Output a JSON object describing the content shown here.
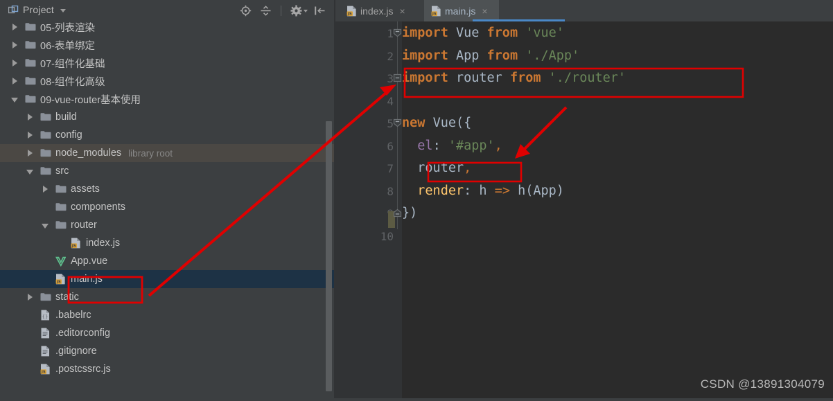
{
  "window": {
    "theme_bg": "#3c3f41",
    "editor_bg": "#2b2b2b",
    "accent": "#4a88c7",
    "annotation_color": "#e00000",
    "selection_bg": "#1d3245"
  },
  "sidebar": {
    "title": "Project",
    "title_caret": "▾",
    "toolbar": [
      {
        "name": "locate-icon",
        "tooltip": "Select Opened File"
      },
      {
        "name": "collapse-all-icon",
        "tooltip": "Collapse All"
      },
      {
        "name": "separator",
        "tooltip": ""
      },
      {
        "name": "gear-icon",
        "tooltip": "Settings"
      },
      {
        "name": "hide-panel-icon",
        "tooltip": "Hide"
      }
    ],
    "tree": [
      {
        "label": "05-列表渲染",
        "indent": 0,
        "kind": "folder",
        "state": "closed",
        "clipped": true
      },
      {
        "label": "06-表单绑定",
        "indent": 0,
        "kind": "folder",
        "state": "closed"
      },
      {
        "label": "07-组件化基础",
        "indent": 0,
        "kind": "folder",
        "state": "closed"
      },
      {
        "label": "08-组件化高级",
        "indent": 0,
        "kind": "folder",
        "state": "closed"
      },
      {
        "label": "09-vue-router基本使用",
        "indent": 0,
        "kind": "folder",
        "state": "open"
      },
      {
        "label": "build",
        "indent": 1,
        "kind": "folder",
        "state": "closed"
      },
      {
        "label": "config",
        "indent": 1,
        "kind": "folder",
        "state": "closed"
      },
      {
        "label": "node_modules",
        "sub": "library root",
        "indent": 1,
        "kind": "folder",
        "state": "closed",
        "hover": true
      },
      {
        "label": "src",
        "indent": 1,
        "kind": "folder",
        "state": "open"
      },
      {
        "label": "assets",
        "indent": 2,
        "kind": "folder",
        "state": "closed"
      },
      {
        "label": "components",
        "indent": 2,
        "kind": "folder",
        "state": "leaf"
      },
      {
        "label": "router",
        "indent": 2,
        "kind": "folder",
        "state": "open"
      },
      {
        "label": "index.js",
        "indent": 3,
        "kind": "js"
      },
      {
        "label": "App.vue",
        "indent": 2,
        "kind": "vue"
      },
      {
        "label": "main.js",
        "indent": 2,
        "kind": "js",
        "selected": true
      },
      {
        "label": "static",
        "indent": 1,
        "kind": "folder",
        "state": "closed"
      },
      {
        "label": ".babelrc",
        "indent": 1,
        "kind": "babel"
      },
      {
        "label": ".editorconfig",
        "indent": 1,
        "kind": "file"
      },
      {
        "label": ".gitignore",
        "indent": 1,
        "kind": "file"
      },
      {
        "label": ".postcssrc.js",
        "indent": 1,
        "kind": "js"
      }
    ]
  },
  "editor": {
    "tabs": [
      {
        "label": "index.js",
        "icon": "js-file-icon",
        "active": false,
        "close": "×"
      },
      {
        "label": "main.js",
        "icon": "js-file-icon",
        "active": true,
        "close": "×"
      }
    ],
    "line_numbers": [
      "1",
      "2",
      "3",
      "4",
      "5",
      "6",
      "7",
      "8",
      "9",
      "10"
    ],
    "lines": [
      {
        "n": 1,
        "text": "import Vue from 'vue'"
      },
      {
        "n": 2,
        "text": "import App from './App'"
      },
      {
        "n": 3,
        "text": "import router from './router'"
      },
      {
        "n": 4,
        "text": ""
      },
      {
        "n": 5,
        "text": "new Vue({"
      },
      {
        "n": 6,
        "text": "  el: '#app',"
      },
      {
        "n": 7,
        "text": "  router,"
      },
      {
        "n": 8,
        "text": "  render: h => h(App)"
      },
      {
        "n": 9,
        "text": "})"
      },
      {
        "n": 10,
        "text": ""
      }
    ]
  },
  "annotations": {
    "boxes": [
      {
        "name": "highlight-import-router",
        "target": "import router from './router'"
      },
      {
        "name": "highlight-router-option",
        "target": "router,"
      },
      {
        "name": "highlight-mainjs-file",
        "target": "main.js"
      }
    ],
    "arrows": [
      {
        "name": "arrow-mainjs-to-import",
        "from": "main.js (tree)",
        "to": "line 3 gutter"
      },
      {
        "name": "arrow-import-to-router-option",
        "from": "import router box",
        "to": "router, line 7"
      }
    ]
  },
  "watermark": {
    "text": "CSDN @13891304079"
  }
}
